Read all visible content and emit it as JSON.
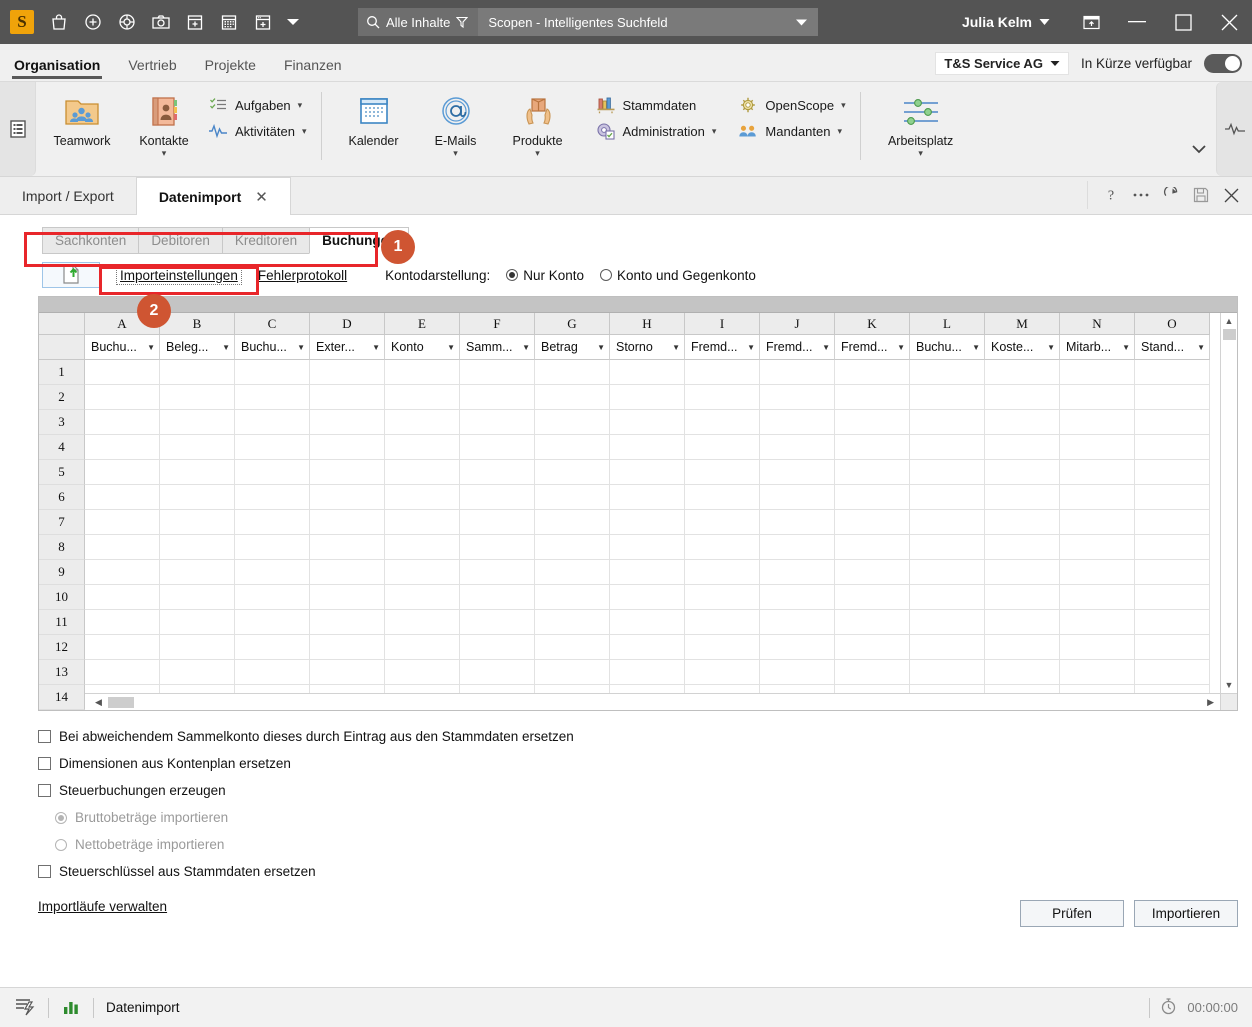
{
  "titlebar": {
    "logo_text": "S",
    "icons": [
      "shopping-bag-icon",
      "plus-circle-icon",
      "lifebuoy-icon",
      "camera-icon",
      "calendar-add-icon",
      "calendar-icon",
      "window-add-icon",
      "chevron-down-icon"
    ],
    "search_scope": "Alle Inhalte",
    "search_placeholder": "Scopen - Intelligentes Suchfeld",
    "user": "Julia Kelm",
    "window_controls": [
      "restore-panel-icon",
      "minimize",
      "maximize",
      "close"
    ]
  },
  "menubar": {
    "items": [
      {
        "label": "Organisation",
        "active": true
      },
      {
        "label": "Vertrieb",
        "active": false
      },
      {
        "label": "Projekte",
        "active": false
      },
      {
        "label": "Finanzen",
        "active": false
      }
    ],
    "mandant": "T&S Service AG",
    "availability_label": "In Kürze verfügbar",
    "availability_on": true
  },
  "ribbon": {
    "groups": [
      {
        "type": "big",
        "items": [
          {
            "label": "Teamwork",
            "icon": "teamwork-folder-icon",
            "dropdown": false
          },
          {
            "label": "Kontakte",
            "icon": "contacts-book-icon",
            "dropdown": true
          }
        ]
      },
      {
        "type": "small",
        "items": [
          {
            "label": "Aufgaben",
            "icon": "tasks-list-icon",
            "dropdown": true
          },
          {
            "label": "Aktivitäten",
            "icon": "activity-pulse-icon",
            "dropdown": true
          }
        ]
      },
      {
        "type": "big",
        "items": [
          {
            "label": "Kalender",
            "icon": "calendar-icon",
            "dropdown": false
          },
          {
            "label": "E-Mails",
            "icon": "at-sign-icon",
            "dropdown": true
          },
          {
            "label": "Produkte",
            "icon": "product-box-hands-icon",
            "dropdown": true
          }
        ]
      },
      {
        "type": "small",
        "items": [
          {
            "label": "Stammdaten",
            "icon": "master-data-books-icon",
            "dropdown": false
          },
          {
            "label": "Administration",
            "icon": "administration-gear-icon",
            "dropdown": true
          }
        ]
      },
      {
        "type": "small",
        "items": [
          {
            "label": "OpenScope",
            "icon": "openscope-icon",
            "dropdown": true
          },
          {
            "label": "Mandanten",
            "icon": "clients-group-icon",
            "dropdown": true
          }
        ]
      },
      {
        "type": "big",
        "items": [
          {
            "label": "Arbeitsplatz",
            "icon": "sliders-icon",
            "dropdown": true
          }
        ]
      }
    ]
  },
  "doctabs": {
    "tabs": [
      {
        "label": "Import / Export",
        "active": false,
        "closable": false
      },
      {
        "label": "Datenimport",
        "active": true,
        "closable": true,
        "close_glyph": "✕"
      }
    ],
    "actions": [
      "help-icon",
      "more-icon",
      "refresh-icon",
      "save-icon",
      "close-icon"
    ]
  },
  "subtabs": [
    {
      "label": "Sachkonten",
      "active": false
    },
    {
      "label": "Debitoren",
      "active": false
    },
    {
      "label": "Kreditoren",
      "active": false
    },
    {
      "label": "Buchungen",
      "active": true
    }
  ],
  "toolbar": {
    "upload_icon": "file-upload-icon",
    "import_settings_link": "Importeinstellungen",
    "error_log_link": "Fehlerprotokoll",
    "konto_label": "Kontodarstellung:",
    "konto_options": [
      {
        "label": "Nur Konto",
        "selected": true
      },
      {
        "label": "Konto und Gegenkonto",
        "selected": false
      }
    ]
  },
  "grid": {
    "column_letters": [
      "A",
      "B",
      "C",
      "D",
      "E",
      "F",
      "G",
      "H",
      "I",
      "J",
      "K",
      "L",
      "M",
      "N",
      "O"
    ],
    "column_names": [
      "Buchu...",
      "Beleg...",
      "Buchu...",
      "Exter...",
      "Konto",
      "Samm...",
      "Betrag",
      "Storno",
      "Fremd...",
      "Fremd...",
      "Fremd...",
      "Buchu...",
      "Koste...",
      "Mitarb...",
      "Stand..."
    ],
    "row_numbers": [
      "1",
      "2",
      "3",
      "4",
      "5",
      "6",
      "7",
      "8",
      "9",
      "10",
      "11",
      "12",
      "13",
      "14"
    ],
    "rows": []
  },
  "options": [
    {
      "label": "Bei abweichendem Sammelkonto dieses durch Eintrag aus den Stammdaten ersetzen",
      "type": "checkbox",
      "checked": false,
      "disabled": false,
      "indent": 0
    },
    {
      "label": "Dimensionen aus Kontenplan ersetzen",
      "type": "checkbox",
      "checked": false,
      "disabled": false,
      "indent": 0
    },
    {
      "label": "Steuerbuchungen erzeugen",
      "type": "checkbox",
      "checked": false,
      "disabled": false,
      "indent": 0
    },
    {
      "label": "Bruttobeträge importieren",
      "type": "radio",
      "checked": true,
      "disabled": true,
      "indent": 1
    },
    {
      "label": "Nettobeträge importieren",
      "type": "radio",
      "checked": false,
      "disabled": true,
      "indent": 1
    },
    {
      "label": "Steuerschlüssel aus Stammdaten ersetzen",
      "type": "checkbox",
      "checked": false,
      "disabled": false,
      "indent": 0
    }
  ],
  "manage_link": "Importläufe verwalten",
  "footer_buttons": [
    {
      "label": "Prüfen"
    },
    {
      "label": "Importieren"
    }
  ],
  "statusbar": {
    "icons": [
      "workflow-icon",
      "chart-bars-icon"
    ],
    "text": "Datenimport",
    "timer_icon": "stopwatch-icon",
    "timer": "00:00:00"
  },
  "annotations": [
    {
      "number": "1"
    },
    {
      "number": "2"
    }
  ],
  "colors": {
    "accent_badge": "#cf5532",
    "highlight_border": "#e8262a",
    "titlebar_bg": "#545454",
    "logo_bg": "#f0a30a"
  }
}
